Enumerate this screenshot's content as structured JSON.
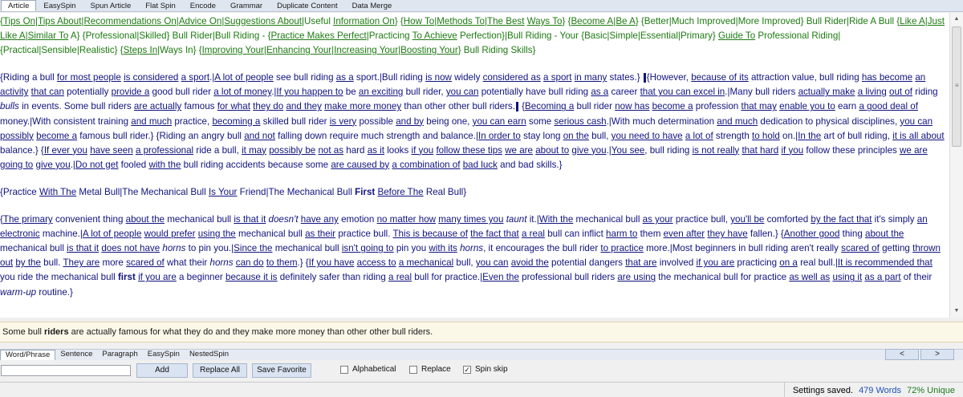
{
  "tabs": [
    "Article",
    "EasySpin",
    "Spun Article",
    "Flat Spin",
    "Encode",
    "Grammar",
    "Duplicate Content",
    "Data Merge"
  ],
  "editor": {
    "paragraphs": [
      {
        "color": "green",
        "html": "{<span class=\"lk\">Tips On</span>|<span class=\"lk\">Tips About</span>|<span class=\"lk\">Recommendations On</span>|<span class=\"lk\">Advice On</span>|<span class=\"lk\">Suggestions About</span>|Useful <span class=\"lk\">Information On</span>} {<span class=\"lk\">How To</span>|<span class=\"lk\">Methods To</span>|<span class=\"lk\">The Best</span> <span class=\"lk\">Ways To</span>} {<span class=\"lk\">Become A</span>|<span class=\"lk\">Be A</span>} {Better|Much Improved|More Improved} Bull Rider|Ride A Bull {<span class=\"lk\">Like A</span>|<span class=\"lk\">Just Like A</span>|<span class=\"lk\">Similar To</span> A} {Professional|Skilled} Bull Rider|Bull Riding - {<span class=\"lk\">Practice Makes Perfect</span>|Practicing <span class=\"lk\">To Achieve</span> Perfection}|Bull Riding - Your {Basic|Simple|Essential|Primary} <span class=\"lk\">Guide To</span> Professional Riding|{Practical|Sensible|Realistic} {<span class=\"lk\">Steps In</span>|Ways In} {<span class=\"lk\">Improving Your</span>|<span class=\"lk\">Enhancing Your</span>|<span class=\"lk\">Increasing Your</span>|<span class=\"lk\">Boosting Your</span>} Bull Riding Skills}"
      },
      {
        "color": "blue",
        "html": "{Riding a bull <span class=\"lk\">for most people</span> <span class=\"lk\">is considered</span> <span class=\"lk\">a sport</span>.|<span class=\"lk\">A lot of people</span> see bull riding <span class=\"lk\">as a</span> sport.|Bull riding <span class=\"lk\">is now</span> widely <span class=\"lk\">considered as</span> <span class=\"lk\">a sport</span> <span class=\"lk\">in many</span> states.} <span class=\"cursor\"></span>{However, <span class=\"lk\">because of its</span> attraction value, bull riding <span class=\"lk\">has become</span> <span class=\"lk\">an activity</span> <span class=\"lk\">that can</span> potentially <span class=\"lk\">provide a</span> good bull rider <span class=\"lk\">a lot of money</span>.|<span class=\"lk\">If you happen to</span> be <span class=\"lk\">an exciting</span> bull rider, <span class=\"lk\">you can</span> potentially have bull riding <span class=\"lk\">as a</span> career <span class=\"lk\">that you can excel in</span>.|Many bull riders <span class=\"lk\">actually make</span> <span class=\"lk\">a living</span> <span class=\"lk\">out of</span> riding <i>bulls</i> in events. Some bull riders <span class=\"lk\">are actually</span> famous <span class=\"lk\">for what</span> <span class=\"lk\">they do</span> <span class=\"lk\">and they</span> <span class=\"lk\">make more money</span> than other other bull riders.<span class=\"cursor\"></span> {<span class=\"lk\">Becoming a</span> bull rider <span class=\"lk\">now has</span> <span class=\"lk\">become a</span> profession <span class=\"lk\">that may</span> <span class=\"lk\">enable you to</span> earn <span class=\"lk\">a good deal of</span> money.|With consistent training <span class=\"lk\">and much</span> practice, <span class=\"lk\">becoming a</span> skilled bull rider <span class=\"lk\">is very</span> possible <span class=\"lk\">and by</span> being one, <span class=\"lk\">you can earn</span> some <span class=\"lk\">serious cash</span>.|With much determination <span class=\"lk\">and much</span> dedication to physical disciplines, <span class=\"lk\">you can possibly</span> <span class=\"lk\">become a</span> famous bull rider.} {Riding an angry bull <span class=\"lk\">and not</span> falling down require much strength and balance.|<span class=\"lk\">In order to</span> stay long <span class=\"lk\">on the</span> bull, <span class=\"lk\">you need to have</span> <span class=\"lk\">a lot of</span> strength <span class=\"lk\">to hold</span> on.|<span class=\"lk\">In the</span> art of bull riding, <span class=\"lk\">it is all about</span> balance.} {<span class=\"lk\">If ever you</span> <span class=\"lk\">have seen</span> <span class=\"lk\">a professional</span> ride a bull, <span class=\"lk\">it may</span> <span class=\"lk\">possibly be</span> <span class=\"lk\">not as</span> hard <span class=\"lk\">as it</span> looks <span class=\"lk\">if you</span> <span class=\"lk\">follow these tips</span> <span class=\"lk\">we are</span> <span class=\"lk\">about to</span> <span class=\"lk\">give you</span>.|<span class=\"lk\">You see</span>, bull riding <span class=\"lk\">is not really</span> <span class=\"lk\">that hard</span> <span class=\"lk\">if you</span> follow these principles <span class=\"lk\">we are going to</span> <span class=\"lk\">give you</span>.|<span class=\"lk\">Do not get</span> fooled <span class=\"lk\">with the</span> bull riding accidents because some <span class=\"lk\">are caused by</span> <span class=\"lk\">a combination of</span> <span class=\"lk\">bad luck</span> and bad skills.}"
      },
      {
        "color": "blue",
        "html": "{Practice <span class=\"lk\">With The</span> Metal Bull|The Mechanical Bull <span class=\"lk\">Is Your</span> Friend|The Mechanical Bull <b>First</b> <span class=\"lk\">Before The</span> Real Bull}"
      },
      {
        "color": "blue",
        "html": "{<span class=\"lk\">The primary</span> convenient thing <span class=\"lk\">about the</span> mechanical bull <span class=\"lk\">is that it</span> <i>doesn't</i> <span class=\"lk\">have any</span> emotion <span class=\"lk\">no matter how</span> <span class=\"lk\">many times you</span> <i>taunt</i> it.|<span class=\"lk\">With the</span> mechanical bull <span class=\"lk\">as your</span> practice bull, <span class=\"lk\">you'll be</span> comforted <span class=\"lk\">by the fact that</span> it's simply <span class=\"lk\">an electronic</span> machine.|<span class=\"lk\">A lot of people</span> <span class=\"lk\">would prefer</span> <span class=\"lk\">using the</span> mechanical bull <span class=\"lk\">as their</span> practice bull. <span class=\"lk\">This is because of</span> <span class=\"lk\">the fact that</span> <span class=\"lk\">a real</span> bull can inflict <span class=\"lk\">harm to</span> them <span class=\"lk\">even after</span> <span class=\"lk\">they have</span> fallen.} {<span class=\"lk\">Another good</span> thing <span class=\"lk\">about the</span> mechanical bull <span class=\"lk\">is that it</span> <span class=\"lk\">does not have</span> <i>horns</i> to pin you.|<span class=\"lk\">Since the</span> mechanical bull <span class=\"lk\">isn't going to</span> pin you <span class=\"lk\">with its</span> <i>horns</i>, it encourages the bull rider <span class=\"lk\">to practice</span> more.|Most beginners in bull riding aren't really <span class=\"lk\">scared of</span> getting <span class=\"lk\">thrown out</span> <span class=\"lk\">by the</span> bull. <span class=\"lk\">They are</span> more <span class=\"lk\">scared of</span> what their <i>horns</i> <span class=\"lk\">can do</span> <span class=\"lk\">to them</span>.} {<span class=\"lk\">If you have</span> <span class=\"lk\">access to</span> <span class=\"lk\">a mechanical</span> bull, <span class=\"lk\">you can</span> <span class=\"lk\">avoid the</span> potential dangers <span class=\"lk\">that are</span> involved <span class=\"lk\">if you are</span> practicing <span class=\"lk\">on a</span> real bull.|<span class=\"lk\">It is recommended that</span> you ride the mechanical bull <b>first</b> <span class=\"lk\">if you are</span> a beginner <span class=\"lk\">because it is</span> definitely safer than riding <span class=\"lk\">a real</span> bull for practice.|<span class=\"lk\">Even the</span> professional bull riders <span class=\"lk\">are using</span> the mechanical bull for practice <span class=\"lk\">as well as</span> <span class=\"lk\">using it</span> <span class=\"lk\">as a part</span> of their <i>warm-up</i> routine.}"
      }
    ]
  },
  "preview": {
    "before": "Some bull ",
    "bold": "riders",
    "after": " are actually famous for what they do and they make more money than other other bull riders."
  },
  "subtabs": [
    "Word/Phrase",
    "Sentence",
    "Paragraph",
    "EasySpin",
    "NestedSpin"
  ],
  "nav": {
    "prev": "<",
    "next": ">"
  },
  "controls": {
    "input_value": "",
    "add": "Add",
    "replace_all": "Replace All",
    "save_favorite": "Save Favorite",
    "alphabetical": "Alphabetical",
    "replace": "Replace",
    "spin_skip": "Spin skip",
    "spin_skip_checked": true,
    "alphabetical_checked": false,
    "replace_checked": false
  },
  "status": {
    "message": "Settings saved.",
    "words": "479 Words",
    "unique": "72% Unique"
  }
}
